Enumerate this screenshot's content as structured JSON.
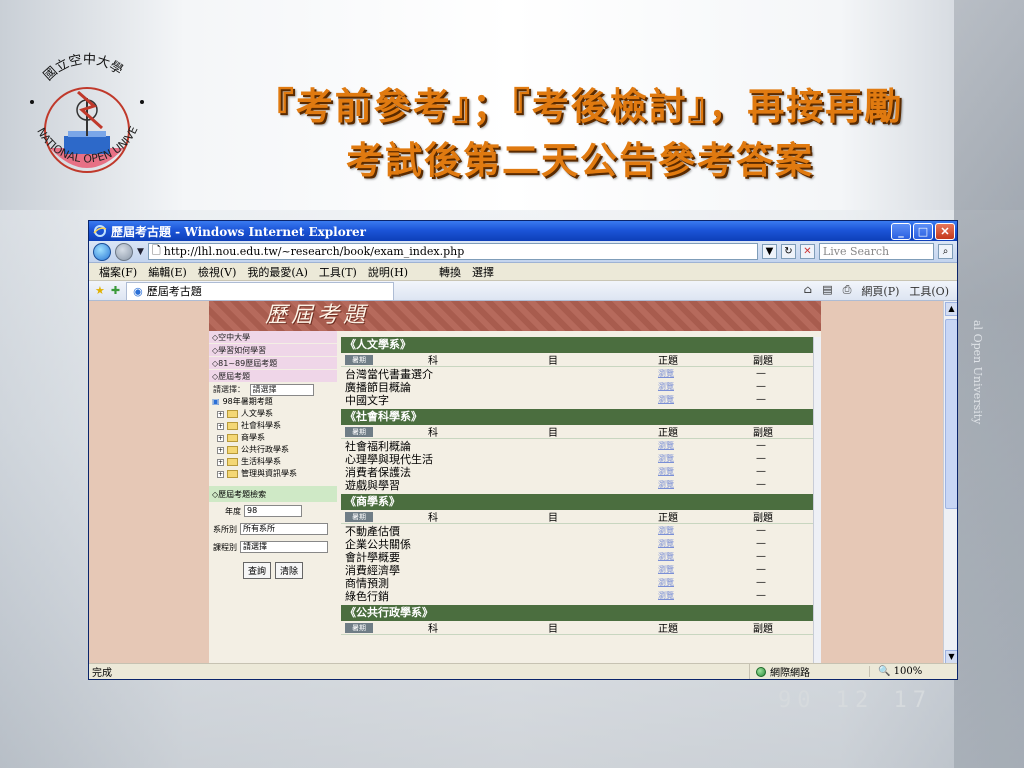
{
  "slide": {
    "title_line1": "『考前參考』；『考後檢討』，再接再勵",
    "title_line2": "考試後第二天公告參考答案",
    "background_vertical_text": "al Open University",
    "background_date_stamp": "90 12 17",
    "title_color": "#e07a10"
  },
  "logo": {
    "top_text": "國立空中大學",
    "arc_text": "NATIONAL OPEN UNIVERSITY"
  },
  "browser": {
    "window_title": "歷屆考古題 - Windows Internet Explorer",
    "url": "http://lhl.nou.edu.tw/~research/book/exam_index.php",
    "search_placeholder": "Live Search",
    "menus": [
      "檔案(F)",
      "編輯(E)",
      "檢視(V)",
      "我的最愛(A)",
      "工具(T)",
      "說明(H)",
      "轉換",
      "選擇"
    ],
    "tab_title": "歷屆考古題",
    "tab_tools": [
      "網頁(P)",
      "工具(O)"
    ],
    "status_text": "完成",
    "status_zone": "網際網路",
    "zoom": "100%"
  },
  "page": {
    "banner_title": "歷屆考題",
    "sidebar": {
      "items": [
        "◇空中大學",
        "◇學習如何學習",
        "◇81~89歷屆考題",
        "◇歷屆考題"
      ],
      "select_label": "請選擇：",
      "select_value": "請選擇",
      "tree_root": "98年暑期考題",
      "tree_items": [
        "人文學系",
        "社會科學系",
        "商學系",
        "公共行政學系",
        "生活科學系",
        "管理與資訊學系"
      ],
      "search_header": "◇歷屆考題檢索",
      "year_label": "年度",
      "year_value": "98",
      "dept_label": "系所別",
      "dept_value": "所有系所",
      "course_label": "課程別",
      "course_value": "請選擇",
      "query_button": "查詢",
      "clear_button": "清除"
    },
    "columns": {
      "category": "暑期",
      "subject1": "科",
      "subject2": "目",
      "main": "正題",
      "sub": "副題"
    },
    "view_text": "瀏覽",
    "dash": "—",
    "sections": [
      {
        "name": "《人文學系》",
        "courses": [
          "台灣當代書畫選介",
          "廣播節目概論",
          "中國文字"
        ]
      },
      {
        "name": "《社會科學系》",
        "courses": [
          "社會福利概論",
          "心理學與現代生活",
          "消費者保護法",
          "遊戲與學習"
        ]
      },
      {
        "name": "《商學系》",
        "courses": [
          "不動產估價",
          "企業公共關係",
          "會計學概要",
          "消費經濟學",
          "商情預測",
          "綠色行銷"
        ]
      },
      {
        "name": "《公共行政學系》",
        "courses": []
      }
    ]
  }
}
